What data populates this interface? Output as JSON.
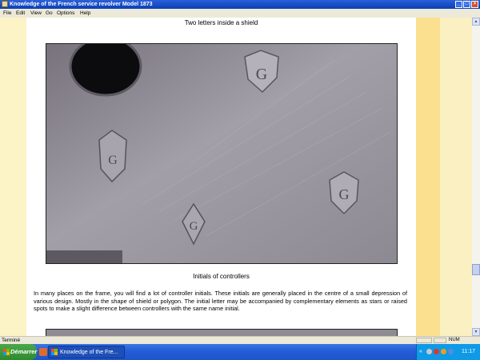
{
  "window": {
    "title": "Knowledge of the French service revolver Model 1873",
    "minimize_glyph": "_",
    "maximize_glyph": "□",
    "close_glyph": "×"
  },
  "menu": {
    "items": [
      "File",
      "Edit",
      "View",
      "Go",
      "Options",
      "Help"
    ]
  },
  "page": {
    "caption_top": "Two letters inside a shield",
    "caption_photo": "Initials of controllers",
    "paragraph": "In many places on the frame, you will find a lot of controller initials. These initials are generally placed in the centre of a small depression of various design. Mostly in the shape of shield or polygon. The initial letter may be accompanied by complementary elements as stars or raised spots to make a slight difference between controllers with the same name initial.",
    "stamp_letter": "G"
  },
  "scrollbar": {
    "up_glyph": "▲",
    "down_glyph": "▼",
    "position": 0.79
  },
  "statusbar": {
    "text": "Terminé",
    "num_indicator": "NUM"
  },
  "taskbar": {
    "start_label": "Démarrer",
    "task_button_label": "Knowledge of the Fre...",
    "tray_chevron": "«",
    "clock": "11:17"
  },
  "colors": {
    "page_background": "#ffffff",
    "side_yellow": "#fbe18f",
    "side_pale": "#fcf3c6",
    "taskbar_blue": "#245edb",
    "start_green": "#2f8a30",
    "tray_blue": "#0f9ae8"
  }
}
